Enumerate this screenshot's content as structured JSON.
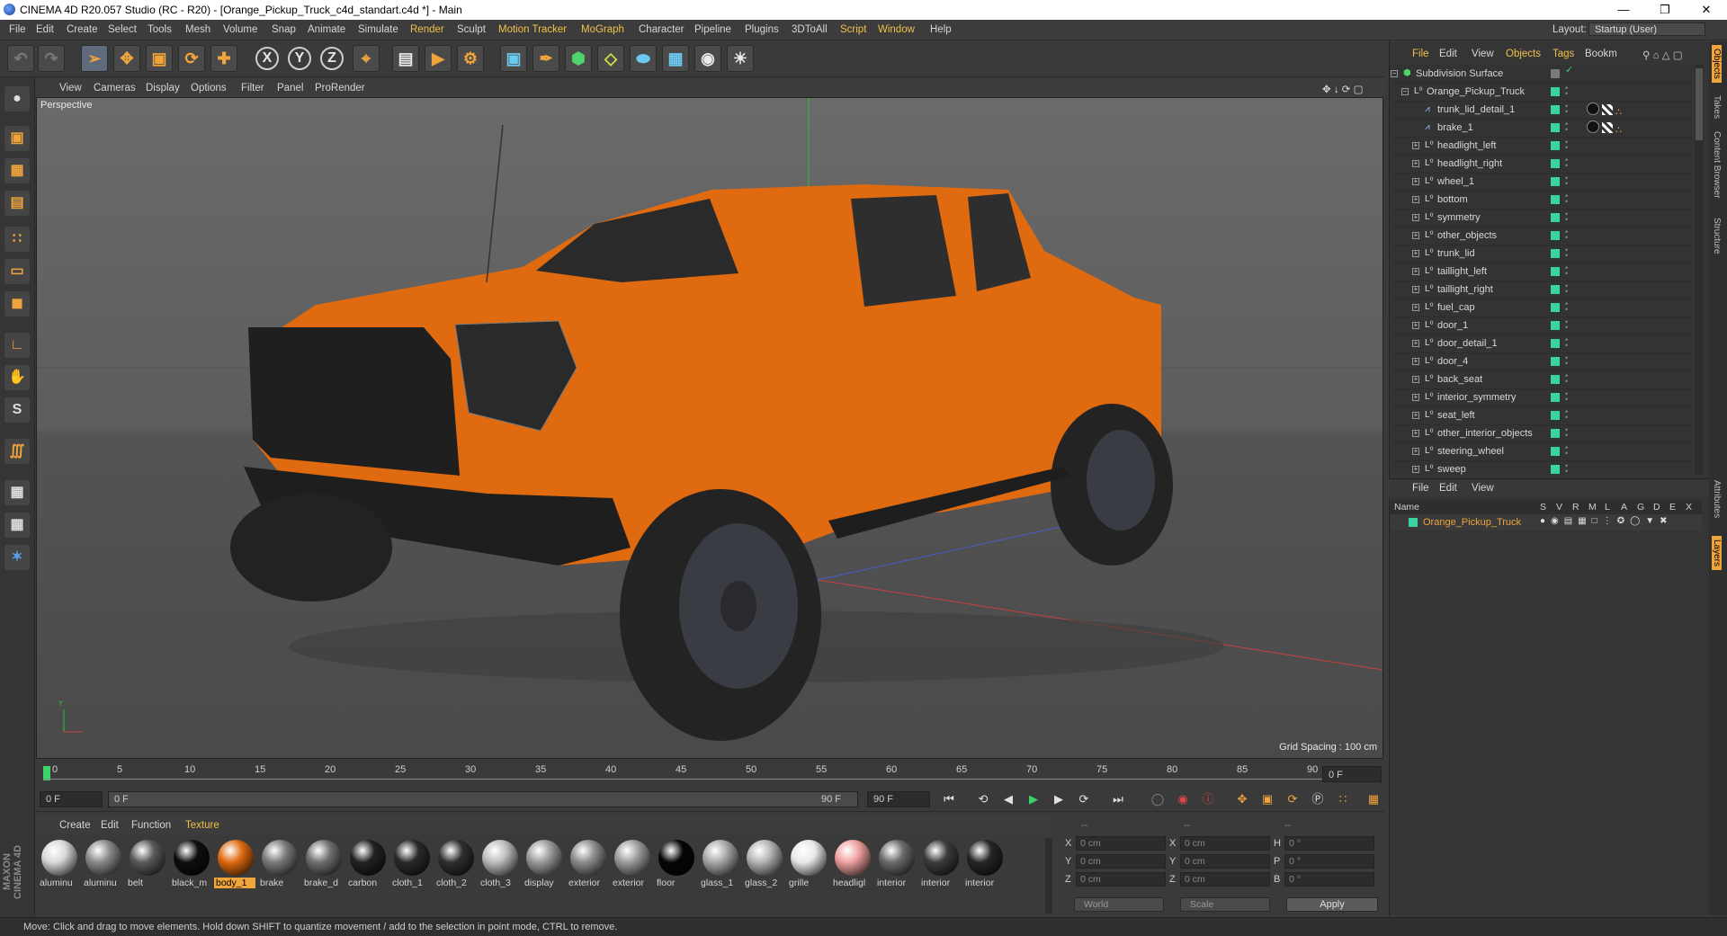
{
  "window": {
    "title": "CINEMA 4D R20.057 Studio (RC - R20) - [Orange_Pickup_Truck_c4d_standart.c4d *] - Main"
  },
  "menubar": [
    "File",
    "Edit",
    "Create",
    "Select",
    "Tools",
    "Mesh",
    "Volume",
    "Snap",
    "Animate",
    "Simulate",
    "Render",
    "Sculpt",
    "Motion Tracker",
    "MoGraph",
    "Character",
    "Pipeline",
    "Plugins",
    "3DToAll",
    "Script",
    "Window",
    "Help"
  ],
  "layout": {
    "label": "Layout:",
    "value": "Startup (User)"
  },
  "viewport": {
    "menu": [
      "View",
      "Cameras",
      "Display",
      "Options",
      "Filter",
      "Panel",
      "ProRender"
    ],
    "label": "Perspective",
    "grid_spacing": "Grid Spacing : 100 cm"
  },
  "timeline": {
    "ticks": [
      "0",
      "5",
      "10",
      "15",
      "20",
      "25",
      "30",
      "35",
      "40",
      "45",
      "50",
      "55",
      "60",
      "65",
      "70",
      "75",
      "80",
      "85",
      "90"
    ],
    "current_frame": "0 F",
    "start_field": "0 F",
    "range_start": "0 F",
    "range_end": "90 F",
    "end_field": "90 F"
  },
  "materials": {
    "menu": [
      "Create",
      "Edit",
      "Function",
      "Texture"
    ],
    "items": [
      {
        "name": "aluminu",
        "color": "#d8d8d8"
      },
      {
        "name": "aluminu",
        "color": "#8a8a8a"
      },
      {
        "name": "belt",
        "color": "#5a5a5a"
      },
      {
        "name": "black_m",
        "color": "#0e0e0e"
      },
      {
        "name": "body_1",
        "color": "#e06a10"
      },
      {
        "name": "brake",
        "color": "#7a7a7a"
      },
      {
        "name": "brake_d",
        "color": "#6f6f6f"
      },
      {
        "name": "carbon",
        "color": "#222222"
      },
      {
        "name": "cloth_1",
        "color": "#2a2a2a"
      },
      {
        "name": "cloth_2",
        "color": "#2f2f2f"
      },
      {
        "name": "cloth_3",
        "color": "#bdbdbd"
      },
      {
        "name": "display",
        "color": "#9a9a9a"
      },
      {
        "name": "exterior",
        "color": "#8c8c8c"
      },
      {
        "name": "exterior",
        "color": "#9c9c9c"
      },
      {
        "name": "floor",
        "color": "#060606"
      },
      {
        "name": "glass_1",
        "color": "#a8a8a8"
      },
      {
        "name": "glass_2",
        "color": "#b4b4b4"
      },
      {
        "name": "grille",
        "color": "#e8e8e8"
      },
      {
        "name": "headligl",
        "color": "#f0a0a0"
      },
      {
        "name": "interior",
        "color": "#6a6a6a"
      },
      {
        "name": "interior",
        "color": "#3c3c3c"
      },
      {
        "name": "interior",
        "color": "#262626"
      }
    ],
    "selected_index": 4
  },
  "coords": {
    "header": [
      "--",
      "--",
      "--"
    ],
    "rows": [
      {
        "a": "X",
        "av": "0 cm",
        "b": "X",
        "bv": "0 cm",
        "c": "H",
        "cv": "0 °"
      },
      {
        "a": "Y",
        "av": "0 cm",
        "b": "Y",
        "bv": "0 cm",
        "c": "P",
        "cv": "0 °"
      },
      {
        "a": "Z",
        "av": "0 cm",
        "b": "Z",
        "bv": "0 cm",
        "c": "B",
        "cv": "0 °"
      }
    ],
    "world": "World",
    "scale": "Scale",
    "apply": "Apply"
  },
  "objects_panel": {
    "menu": [
      "File",
      "Edit",
      "View",
      "Objects",
      "Tags",
      "Bookm"
    ],
    "items": [
      {
        "name": "Subdivision Surface",
        "depth": 0,
        "icon": "subdivision"
      },
      {
        "name": "Orange_Pickup_Truck",
        "depth": 1,
        "icon": "null"
      },
      {
        "name": "trunk_lid_detail_1",
        "depth": 2,
        "icon": "joint",
        "tags": true
      },
      {
        "name": "brake_1",
        "depth": 2,
        "icon": "joint",
        "tags": true
      },
      {
        "name": "headlight_left",
        "depth": 2,
        "icon": "null"
      },
      {
        "name": "headlight_right",
        "depth": 2,
        "icon": "null"
      },
      {
        "name": "wheel_1",
        "depth": 2,
        "icon": "null"
      },
      {
        "name": "bottom",
        "depth": 2,
        "icon": "null"
      },
      {
        "name": "symmetry",
        "depth": 2,
        "icon": "null"
      },
      {
        "name": "other_objects",
        "depth": 2,
        "icon": "null"
      },
      {
        "name": "trunk_lid",
        "depth": 2,
        "icon": "null"
      },
      {
        "name": "taillight_left",
        "depth": 2,
        "icon": "null"
      },
      {
        "name": "taillight_right",
        "depth": 2,
        "icon": "null"
      },
      {
        "name": "fuel_cap",
        "depth": 2,
        "icon": "null"
      },
      {
        "name": "door_1",
        "depth": 2,
        "icon": "null"
      },
      {
        "name": "door_detail_1",
        "depth": 2,
        "icon": "null"
      },
      {
        "name": "door_4",
        "depth": 2,
        "icon": "null"
      },
      {
        "name": "back_seat",
        "depth": 2,
        "icon": "null"
      },
      {
        "name": "interior_symmetry",
        "depth": 2,
        "icon": "null"
      },
      {
        "name": "seat_left",
        "depth": 2,
        "icon": "null"
      },
      {
        "name": "other_interior_objects",
        "depth": 2,
        "icon": "null"
      },
      {
        "name": "steering_wheel",
        "depth": 2,
        "icon": "null"
      },
      {
        "name": "sweep",
        "depth": 2,
        "icon": "null"
      }
    ]
  },
  "layers_panel": {
    "menu": [
      "File",
      "Edit",
      "View"
    ],
    "columns": [
      "Name",
      "S",
      "V",
      "R",
      "M",
      "L",
      "A",
      "G",
      "D",
      "E",
      "X"
    ],
    "row": "Orange_Pickup_Truck"
  },
  "side_tabs": [
    "Objects",
    "Takes",
    "Content Browser",
    "Structure",
    "Attributes",
    "Layers"
  ],
  "status": "Move: Click and drag to move elements. Hold down SHIFT to quantize movement / add to the selection in point mode, CTRL to remove.",
  "colors": {
    "accent": "#f0a43c",
    "object_green": "#3bd3a0",
    "truck_orange": "#e06a10"
  },
  "maxon_logo": "MAXON CINEMA 4D"
}
